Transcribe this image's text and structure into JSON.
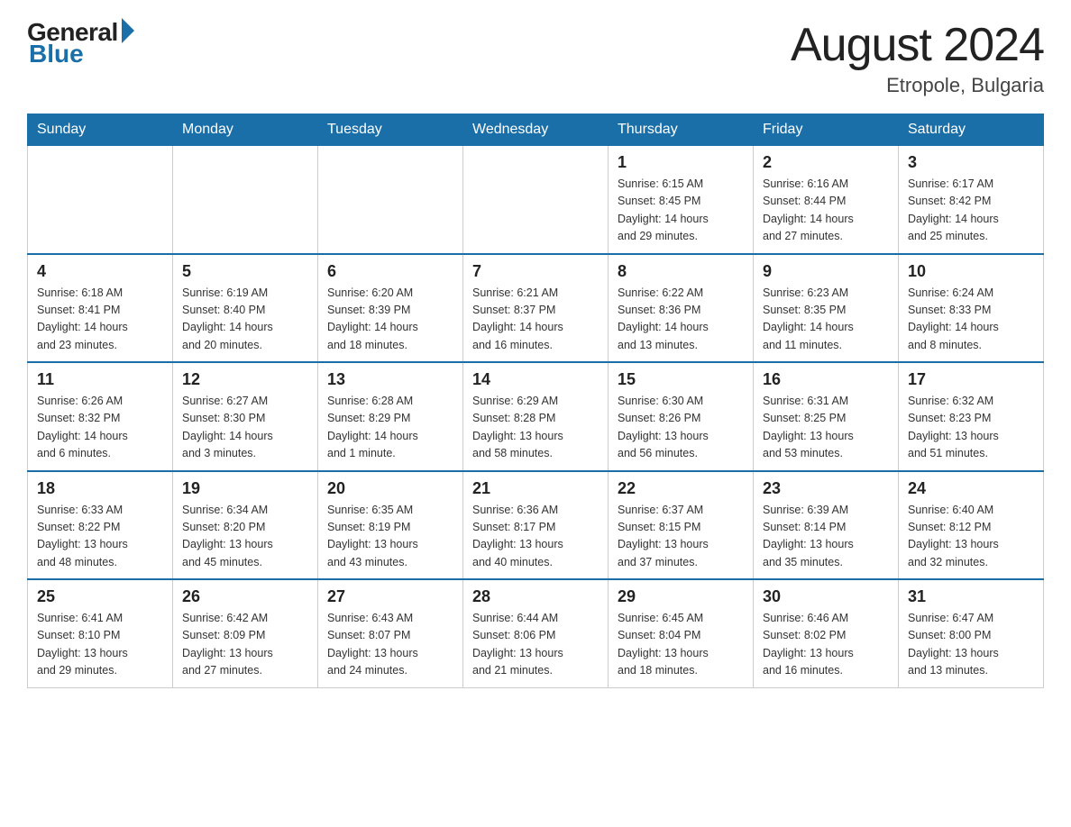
{
  "header": {
    "logo_general": "General",
    "logo_blue": "Blue",
    "month_title": "August 2024",
    "location": "Etropole, Bulgaria"
  },
  "weekdays": [
    "Sunday",
    "Monday",
    "Tuesday",
    "Wednesday",
    "Thursday",
    "Friday",
    "Saturday"
  ],
  "weeks": [
    [
      {
        "day": "",
        "info": ""
      },
      {
        "day": "",
        "info": ""
      },
      {
        "day": "",
        "info": ""
      },
      {
        "day": "",
        "info": ""
      },
      {
        "day": "1",
        "info": "Sunrise: 6:15 AM\nSunset: 8:45 PM\nDaylight: 14 hours\nand 29 minutes."
      },
      {
        "day": "2",
        "info": "Sunrise: 6:16 AM\nSunset: 8:44 PM\nDaylight: 14 hours\nand 27 minutes."
      },
      {
        "day": "3",
        "info": "Sunrise: 6:17 AM\nSunset: 8:42 PM\nDaylight: 14 hours\nand 25 minutes."
      }
    ],
    [
      {
        "day": "4",
        "info": "Sunrise: 6:18 AM\nSunset: 8:41 PM\nDaylight: 14 hours\nand 23 minutes."
      },
      {
        "day": "5",
        "info": "Sunrise: 6:19 AM\nSunset: 8:40 PM\nDaylight: 14 hours\nand 20 minutes."
      },
      {
        "day": "6",
        "info": "Sunrise: 6:20 AM\nSunset: 8:39 PM\nDaylight: 14 hours\nand 18 minutes."
      },
      {
        "day": "7",
        "info": "Sunrise: 6:21 AM\nSunset: 8:37 PM\nDaylight: 14 hours\nand 16 minutes."
      },
      {
        "day": "8",
        "info": "Sunrise: 6:22 AM\nSunset: 8:36 PM\nDaylight: 14 hours\nand 13 minutes."
      },
      {
        "day": "9",
        "info": "Sunrise: 6:23 AM\nSunset: 8:35 PM\nDaylight: 14 hours\nand 11 minutes."
      },
      {
        "day": "10",
        "info": "Sunrise: 6:24 AM\nSunset: 8:33 PM\nDaylight: 14 hours\nand 8 minutes."
      }
    ],
    [
      {
        "day": "11",
        "info": "Sunrise: 6:26 AM\nSunset: 8:32 PM\nDaylight: 14 hours\nand 6 minutes."
      },
      {
        "day": "12",
        "info": "Sunrise: 6:27 AM\nSunset: 8:30 PM\nDaylight: 14 hours\nand 3 minutes."
      },
      {
        "day": "13",
        "info": "Sunrise: 6:28 AM\nSunset: 8:29 PM\nDaylight: 14 hours\nand 1 minute."
      },
      {
        "day": "14",
        "info": "Sunrise: 6:29 AM\nSunset: 8:28 PM\nDaylight: 13 hours\nand 58 minutes."
      },
      {
        "day": "15",
        "info": "Sunrise: 6:30 AM\nSunset: 8:26 PM\nDaylight: 13 hours\nand 56 minutes."
      },
      {
        "day": "16",
        "info": "Sunrise: 6:31 AM\nSunset: 8:25 PM\nDaylight: 13 hours\nand 53 minutes."
      },
      {
        "day": "17",
        "info": "Sunrise: 6:32 AM\nSunset: 8:23 PM\nDaylight: 13 hours\nand 51 minutes."
      }
    ],
    [
      {
        "day": "18",
        "info": "Sunrise: 6:33 AM\nSunset: 8:22 PM\nDaylight: 13 hours\nand 48 minutes."
      },
      {
        "day": "19",
        "info": "Sunrise: 6:34 AM\nSunset: 8:20 PM\nDaylight: 13 hours\nand 45 minutes."
      },
      {
        "day": "20",
        "info": "Sunrise: 6:35 AM\nSunset: 8:19 PM\nDaylight: 13 hours\nand 43 minutes."
      },
      {
        "day": "21",
        "info": "Sunrise: 6:36 AM\nSunset: 8:17 PM\nDaylight: 13 hours\nand 40 minutes."
      },
      {
        "day": "22",
        "info": "Sunrise: 6:37 AM\nSunset: 8:15 PM\nDaylight: 13 hours\nand 37 minutes."
      },
      {
        "day": "23",
        "info": "Sunrise: 6:39 AM\nSunset: 8:14 PM\nDaylight: 13 hours\nand 35 minutes."
      },
      {
        "day": "24",
        "info": "Sunrise: 6:40 AM\nSunset: 8:12 PM\nDaylight: 13 hours\nand 32 minutes."
      }
    ],
    [
      {
        "day": "25",
        "info": "Sunrise: 6:41 AM\nSunset: 8:10 PM\nDaylight: 13 hours\nand 29 minutes."
      },
      {
        "day": "26",
        "info": "Sunrise: 6:42 AM\nSunset: 8:09 PM\nDaylight: 13 hours\nand 27 minutes."
      },
      {
        "day": "27",
        "info": "Sunrise: 6:43 AM\nSunset: 8:07 PM\nDaylight: 13 hours\nand 24 minutes."
      },
      {
        "day": "28",
        "info": "Sunrise: 6:44 AM\nSunset: 8:06 PM\nDaylight: 13 hours\nand 21 minutes."
      },
      {
        "day": "29",
        "info": "Sunrise: 6:45 AM\nSunset: 8:04 PM\nDaylight: 13 hours\nand 18 minutes."
      },
      {
        "day": "30",
        "info": "Sunrise: 6:46 AM\nSunset: 8:02 PM\nDaylight: 13 hours\nand 16 minutes."
      },
      {
        "day": "31",
        "info": "Sunrise: 6:47 AM\nSunset: 8:00 PM\nDaylight: 13 hours\nand 13 minutes."
      }
    ]
  ]
}
